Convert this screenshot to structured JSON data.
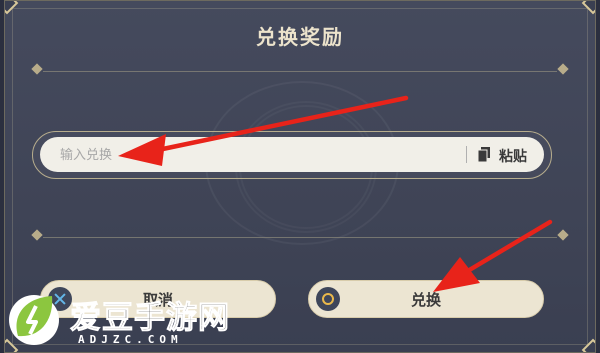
{
  "dialog": {
    "title": "兑换奖励",
    "input_placeholder": "输入兑换",
    "paste_label": "粘贴",
    "cancel_label": "取消",
    "redeem_label": "兑换"
  },
  "watermark": {
    "name": "爱豆手游网",
    "url": "ADJZC.COM"
  },
  "colors": {
    "dialog_bg": "#42475a",
    "accent_gold": "#d8c89a",
    "button_bg": "#ece5d2",
    "arrow": "#e8231a",
    "cancel_icon": "#63b6e8",
    "confirm_icon": "#e9b84b"
  },
  "icons": {
    "paste": "clipboard-icon",
    "cancel": "x-icon",
    "confirm": "circle-icon"
  }
}
